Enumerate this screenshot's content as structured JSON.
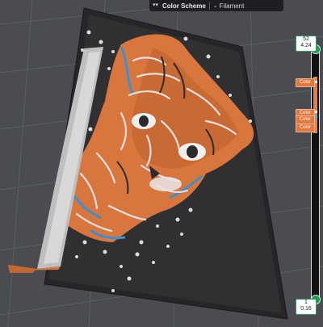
{
  "topbar": {
    "scheme_label": "Color Scheme",
    "filament_value": "Filament",
    "collapse_icon": "double-chevron-down-icon",
    "dropdown_icon": "chevron-down-icon"
  },
  "layer_slider": {
    "top_layer": "52",
    "top_height": "4.24",
    "bottom_layer": "1",
    "bottom_height": "0.16",
    "color_tags": [
      "Color",
      "Color",
      "Color",
      "Color"
    ]
  },
  "colors": {
    "background": "#4a4c51",
    "bed": "#2a2a2c",
    "filament_orange": "#d9763e",
    "filament_white": "#d6d6d6",
    "filament_blue": "#3d8fcf",
    "handle_green": "#1d9a4f"
  }
}
